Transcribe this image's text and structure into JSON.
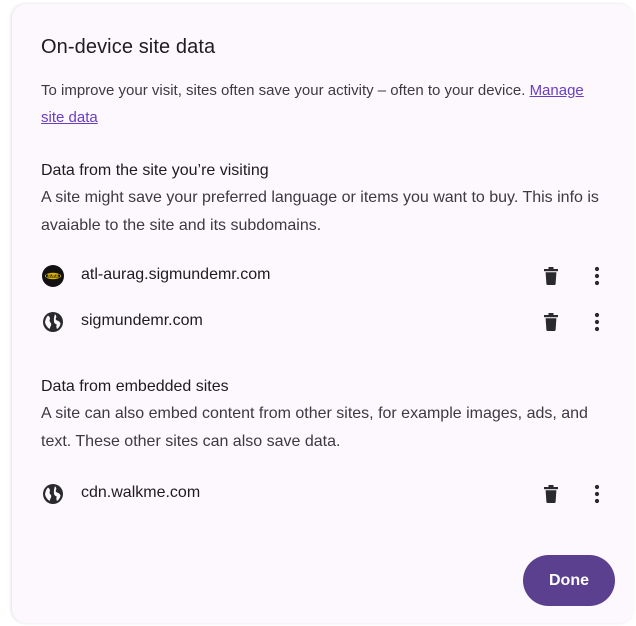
{
  "dialog": {
    "title": "On-device site data",
    "intro_text": "To improve your visit, sites often save your activity – often to your device. ",
    "manage_link": "Manage site data",
    "done_label": "Done"
  },
  "sections": {
    "visiting": {
      "title": "Data from the site you’re visiting",
      "description": "A site might save your preferred language or items you want to buy. This info is avaiable to the site and its subdomains.",
      "sites": [
        {
          "name": "atl-aurag.sigmundemr.com",
          "icon": "aura-logo-icon"
        },
        {
          "name": "sigmundemr.com",
          "icon": "globe-icon"
        }
      ]
    },
    "embedded": {
      "title": "Data from embedded sites",
      "description": "A site can also embed content from other sites, for example images, ads, and text. These other sites can also save data.",
      "sites": [
        {
          "name": "cdn.walkme.com",
          "icon": "globe-icon"
        }
      ]
    }
  },
  "colors": {
    "dialog_background": "#fdf7fe",
    "accent": "#5b4090",
    "link": "#6a3ec2",
    "icon": "#2a2a2e"
  }
}
